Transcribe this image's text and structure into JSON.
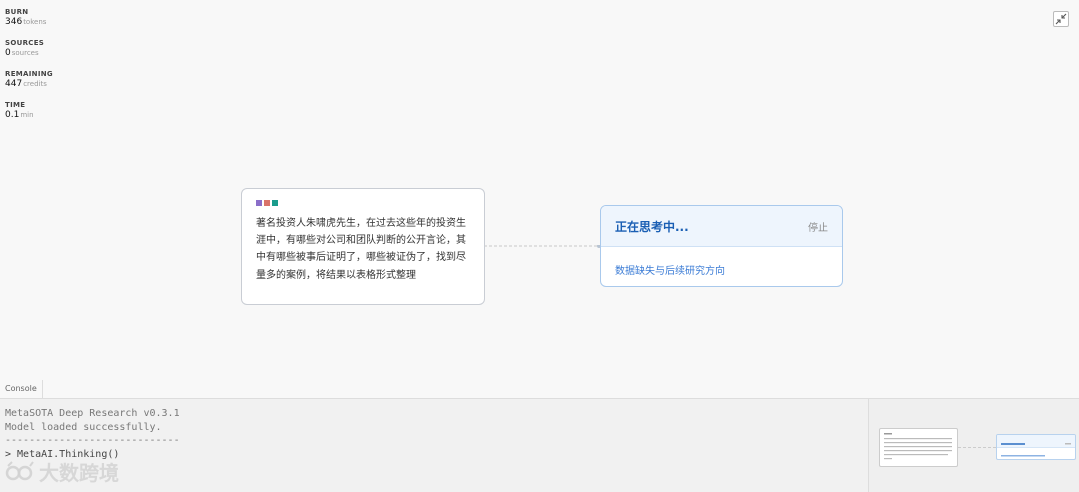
{
  "stats": [
    {
      "label": "BURN",
      "value": "346",
      "unit": "tokens"
    },
    {
      "label": "SOURCES",
      "value": "0",
      "unit": "sources"
    },
    {
      "label": "REMAINING",
      "value": "447",
      "unit": "credits"
    },
    {
      "label": "TIME",
      "value": "0.1",
      "unit": "min"
    }
  ],
  "query_card": {
    "dot_colors": [
      "#8a6ec9",
      "#d9736a",
      "#1a9c8c"
    ],
    "text": "著名投资人朱啸虎先生，在过去这些年的投资生涯中，有哪些对公司和团队判断的公开言论，其中有哪些被事后证明了，哪些被证伪了，找到尽量多的案例，将结果以表格形式整理"
  },
  "status_card": {
    "title": "正在思考中...",
    "stop_label": "停止",
    "body": "数据缺失与后续研究方向"
  },
  "console": {
    "tab_label": "Console",
    "lines": [
      "MetaSOTA Deep Research v0.3.1",
      "Model loaded successfully.",
      "-----------------------------",
      "> MetaAI.Thinking()"
    ]
  },
  "watermark": {
    "text": "大数跨境"
  },
  "colors": {
    "accent": "#1a5fb4",
    "link": "#3a7bd5",
    "status_border": "#a9c9ec"
  }
}
